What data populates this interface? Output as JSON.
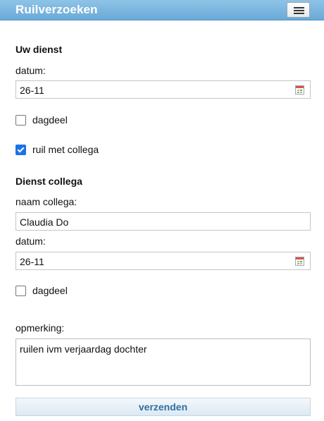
{
  "header": {
    "title": "Ruilverzoeken",
    "menu_icon": "hamburger-icon"
  },
  "own_shift": {
    "title": "Uw dienst",
    "date_label": "datum:",
    "date_value": "26-11",
    "part_of_day_label": "dagdeel",
    "part_of_day_checked": false,
    "swap_with_colleague_label": "ruil met collega",
    "swap_with_colleague_checked": true
  },
  "colleague_shift": {
    "title": "Dienst collega",
    "name_label": "naam collega:",
    "name_value": "Claudia Do",
    "date_label": "datum:",
    "date_value": "26-11",
    "part_of_day_label": "dagdeel",
    "part_of_day_checked": false
  },
  "remark": {
    "label": "opmerking:",
    "value": "ruilen ivm verjaardag dochter"
  },
  "submit": {
    "label": "verzenden"
  },
  "colors": {
    "header": "#6aa9d8",
    "accent": "#1a73e8",
    "submit_text": "#2f6f9f"
  }
}
